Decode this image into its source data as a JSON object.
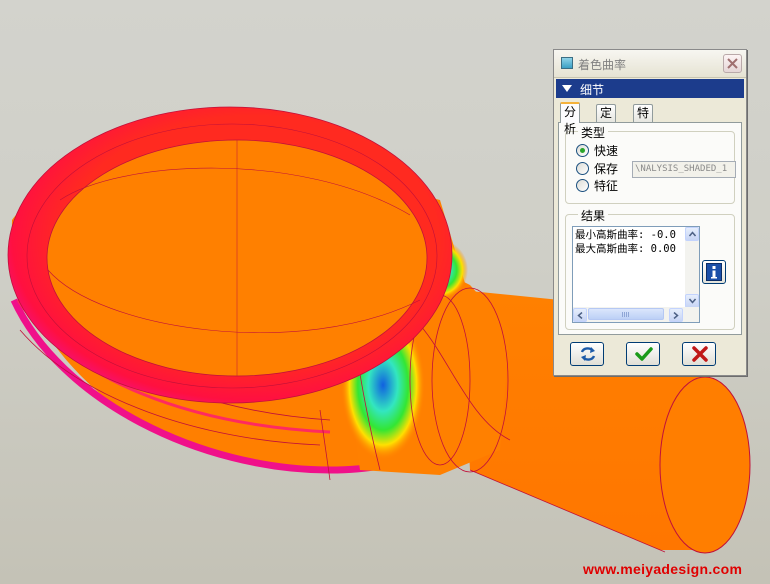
{
  "viewport": {
    "model": "shaded-curvature-part",
    "colors": {
      "background_top": "#d3d3cd",
      "body": "#ff7f00",
      "rim": "#ff1a40",
      "edge": "#e0105a",
      "hot_green": "#33e633",
      "hot_blue": "#1060e0",
      "hot_yellow": "#ffe000",
      "outline": "#c0103a"
    }
  },
  "watermark": {
    "text": "www.meiyadesign.com",
    "color": "#e00000"
  },
  "dialog": {
    "title": "着色曲率",
    "title_icon": "window-app-icon",
    "close_icon": "close-icon",
    "section": {
      "label": "细节",
      "icon": "triangle-down-icon"
    },
    "tabs": [
      {
        "label": "分析",
        "active": true
      },
      {
        "label": "定义",
        "active": false
      },
      {
        "label": "特征",
        "active": false
      }
    ],
    "type_group": {
      "title": "类型",
      "options": [
        {
          "label": "快速",
          "selected": true
        },
        {
          "label": "保存",
          "selected": false
        },
        {
          "label": "特征",
          "selected": false
        }
      ],
      "name_value": "\\NALYSIS_SHADED_1"
    },
    "results_group": {
      "title": "结果",
      "lines": [
        "最小高斯曲率: -0.0",
        "最大高斯曲率: 0.00"
      ]
    },
    "info_icon": "info-icon",
    "buttons": [
      {
        "name": "refresh",
        "icon": "refresh-icon",
        "color": "#1c5aa8"
      },
      {
        "name": "ok",
        "icon": "checkmark-icon",
        "color": "#1a9a1a"
      },
      {
        "name": "cancel",
        "icon": "cross-icon",
        "color": "#c01818"
      }
    ]
  }
}
